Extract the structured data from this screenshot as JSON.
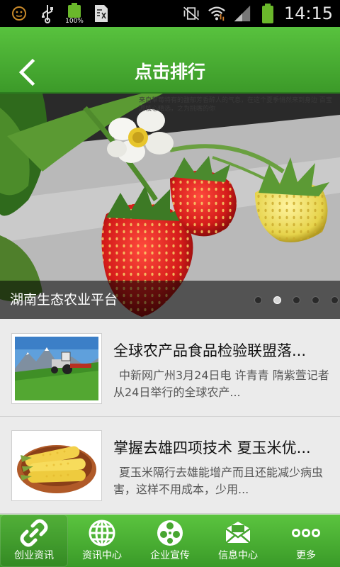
{
  "status_bar": {
    "battery_small_label": "100%",
    "time": "14:15"
  },
  "header": {
    "title": "点击排行"
  },
  "banner": {
    "caption": "湖南生态农业平台",
    "overlay_text": "来自草莓特有的馥郁芳香醉人的气息，在这个夏季悄然来到身边 百宝源核心精选，之为挑嘴的你",
    "dots_total": 5,
    "active_dot": 1
  },
  "news": [
    {
      "title": "全球农产品食品检验联盟落...",
      "desc": "中新网广州3月24日电 许青青 隋紫萱记者从24日举行的全球农产...",
      "thumb_icon": "tractor-field-image"
    },
    {
      "title": "掌握去雄四项技术 夏玉米优...",
      "desc": "夏玉米隔行去雄能增产而且还能减少病虫害，这样不用成本，少用...",
      "thumb_icon": "corn-basket-image"
    }
  ],
  "bottom_nav": {
    "items": [
      {
        "label": "创业资讯",
        "icon": "link-icon",
        "active": true
      },
      {
        "label": "资讯中心",
        "icon": "globe-icon",
        "active": false
      },
      {
        "label": "企业宣传",
        "icon": "film-reel-icon",
        "active": false
      },
      {
        "label": "信息中心",
        "icon": "mail-icon",
        "active": false
      },
      {
        "label": "更多",
        "icon": "more-dots-icon",
        "active": false
      }
    ]
  },
  "colors": {
    "header_green": "#4caf34",
    "nav_green": "#4cb236",
    "background": "#ebebeb"
  }
}
